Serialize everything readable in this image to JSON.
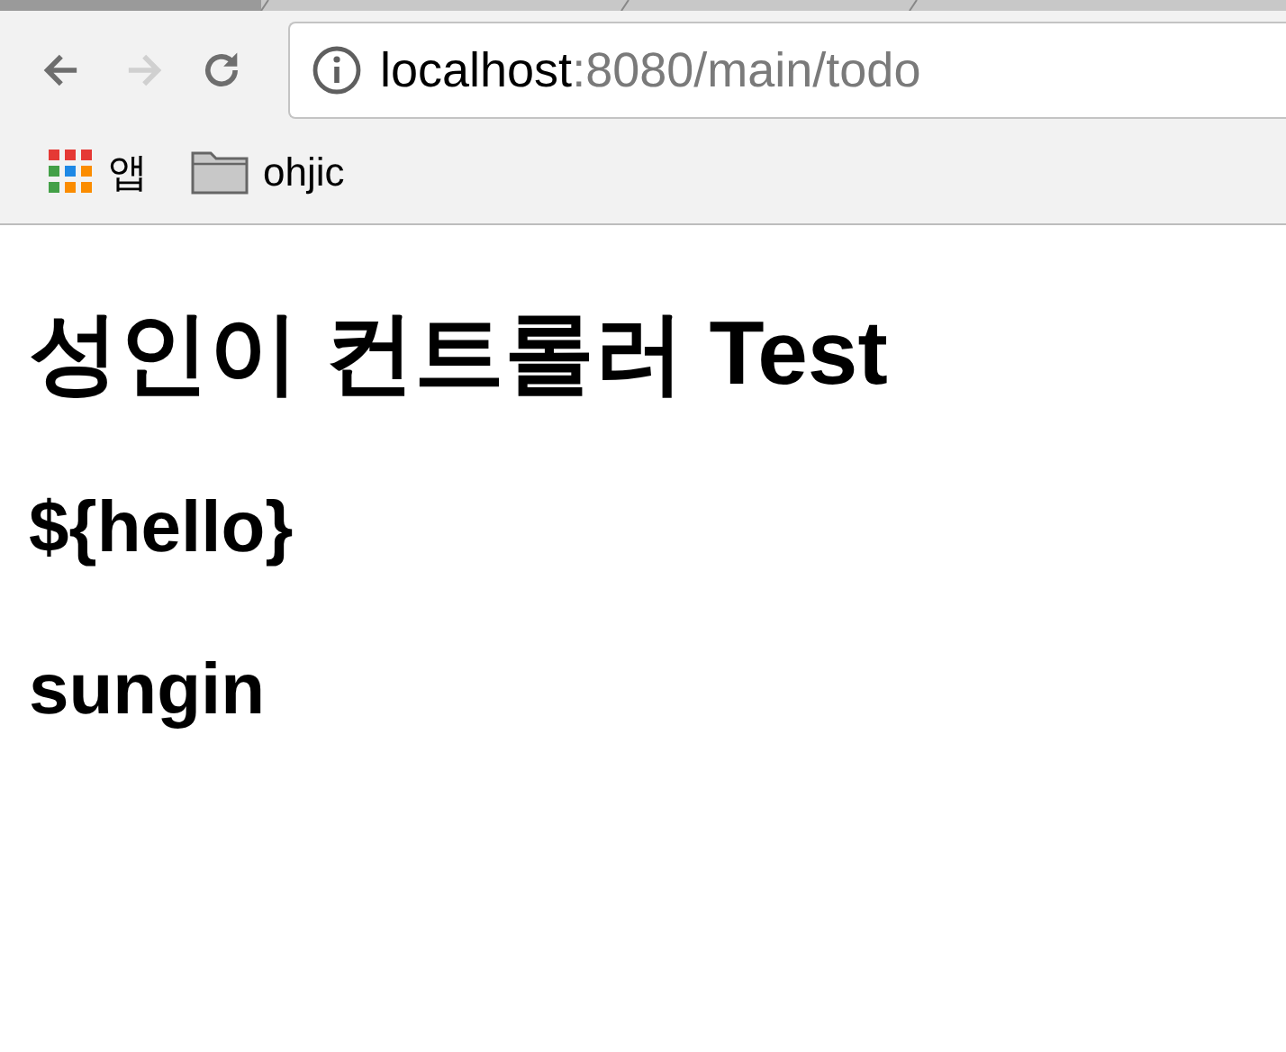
{
  "browser": {
    "nav": [
      {
        "kind": "back",
        "disabled": false
      },
      {
        "kind": "forward",
        "disabled": true
      },
      {
        "kind": "reload",
        "disabled": false
      }
    ],
    "address": {
      "host": "localhost",
      "rest": ":8080/main/todo"
    },
    "bookmarks": [
      {
        "kind": "apps",
        "label": "앱"
      },
      {
        "kind": "folder",
        "label": "ohjic"
      }
    ]
  },
  "page": {
    "title": "성인이 컨트롤러 Test",
    "lines": [
      "${hello}",
      "sungin"
    ]
  }
}
